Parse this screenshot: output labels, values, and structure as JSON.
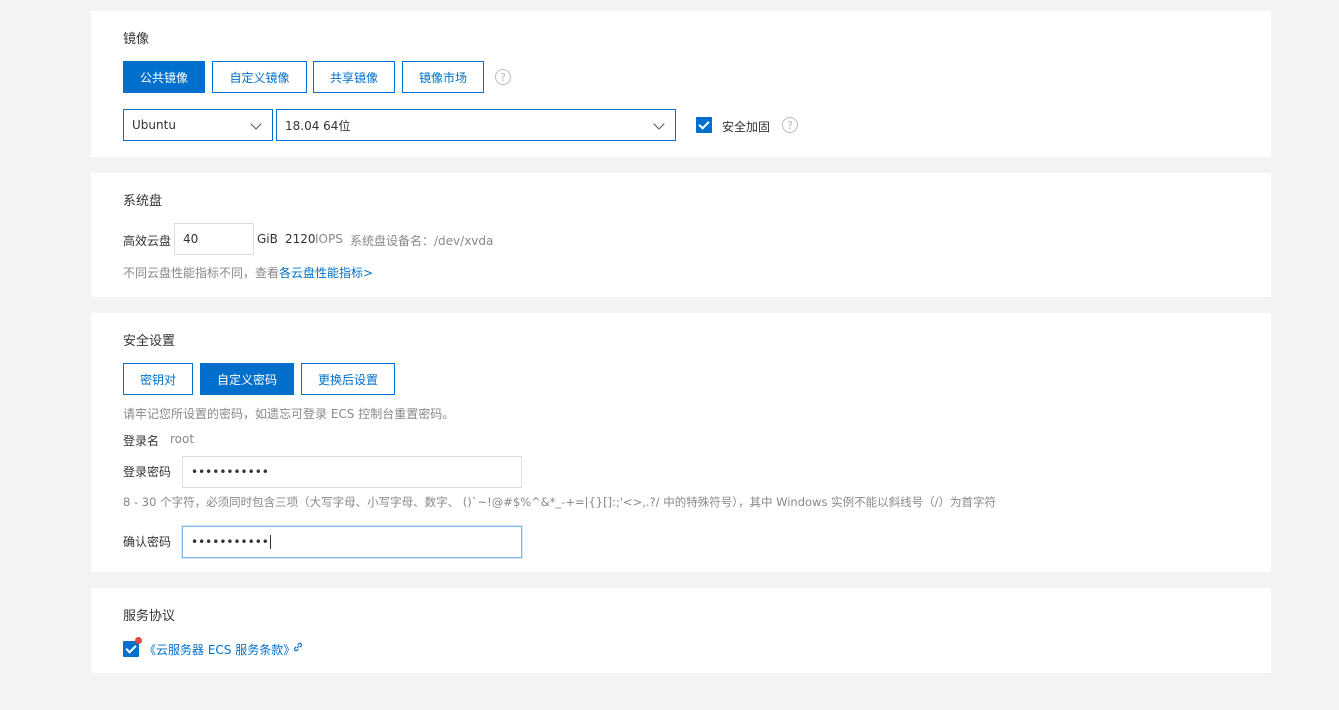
{
  "image": {
    "title": "镜像",
    "tabs": [
      "公共镜像",
      "自定义镜像",
      "共享镜像",
      "镜像市场"
    ],
    "help": "?",
    "os": "Ubuntu",
    "version": "18.04 64位",
    "security_label": "安全加固"
  },
  "disk": {
    "title": "系统盘",
    "type_label": "高效云盘",
    "size": "40",
    "unit": "GiB",
    "iops_value": "2120",
    "iops_label": "IOPS",
    "device_label": "系统盘设备名：/dev/xvda",
    "hint_prefix": "不同云盘性能指标不同，查看",
    "hint_link": "各云盘性能指标>"
  },
  "security": {
    "title": "安全设置",
    "tabs": [
      "密钥对",
      "自定义密码",
      "更换后设置"
    ],
    "notice": "请牢记您所设置的密码，如遗忘可登录 ECS 控制台重置密码。",
    "login_name_label": "登录名",
    "login_name_value": "root",
    "password_label": "登录密码",
    "password_value": "•••••••••••",
    "password_rule": "8 - 30 个字符，必须同时包含三项（大写字母、小写字母、数字、 ()`~!@#$%^&*_-+=|{}[]:;'<>,.?/ 中的特殊符号），其中 Windows 实例不能以斜线号（/）为首字符",
    "confirm_label": "确认密码",
    "confirm_value": "•••••••••••"
  },
  "agreement": {
    "title": "服务协议",
    "link": "《云服务器 ECS 服务条款》"
  },
  "colors": {
    "accent": "#0070cc",
    "background": "#f2f3f5",
    "alert_dot": "#e8453c"
  }
}
